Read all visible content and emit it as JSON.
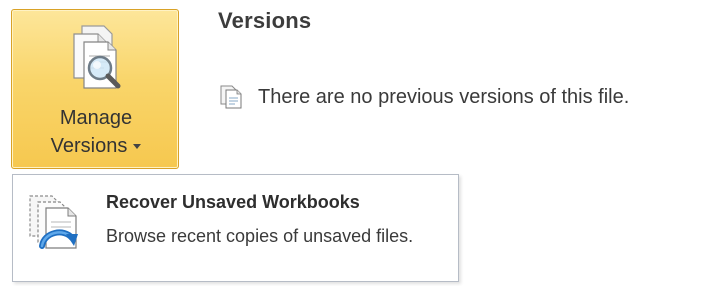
{
  "backstage": {
    "manage_versions": {
      "label_line1": "Manage",
      "label_line2": "Versions",
      "icon": "manage-versions-icon"
    },
    "versions_section": {
      "title": "Versions",
      "message": "There are no previous versions of this file.",
      "icon": "document-versions-icon"
    },
    "menu": {
      "items": [
        {
          "title": "Recover Unsaved Workbooks",
          "description": "Browse recent copies of unsaved files.",
          "icon": "recover-workbook-icon"
        }
      ]
    }
  },
  "colors": {
    "button_highlight_top": "#fde69a",
    "button_highlight_bottom": "#f6c84f",
    "button_border": "#d9a227",
    "menu_border": "#b6bcc6"
  }
}
